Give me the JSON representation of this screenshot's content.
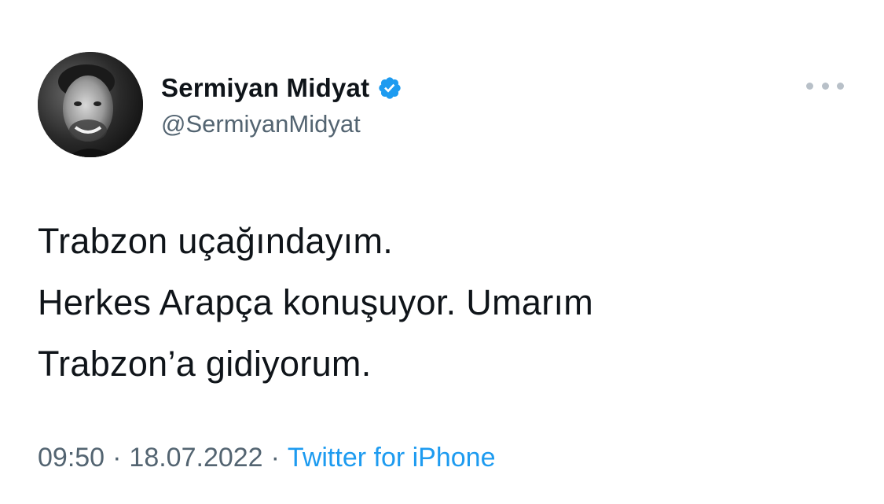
{
  "author": {
    "display_name": "Sermiyan Midyat",
    "handle": "@SermiyanMidyat",
    "verified": true
  },
  "tweet": {
    "lines": [
      "Trabzon uçağındayım.",
      "Herkes Arapça konuşuyor. Umarım",
      "Trabzon’a gidiyorum."
    ]
  },
  "meta": {
    "time": "09:50",
    "separator": "·",
    "date": "18.07.2022",
    "source": "Twitter for iPhone"
  },
  "colors": {
    "text": "#0f1419",
    "secondary_text": "#536471",
    "accent": "#1d9bf0",
    "verified_badge": "#1d9bf0"
  },
  "icons": {
    "verified": "verified-badge-icon",
    "more": "more-options-icon"
  }
}
